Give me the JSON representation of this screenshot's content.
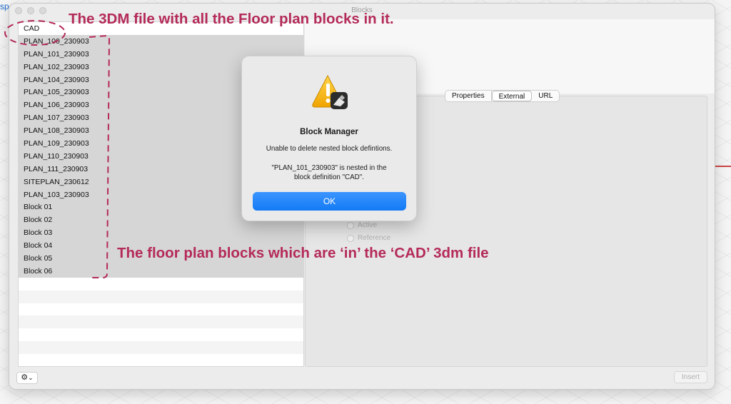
{
  "backdrop": {
    "left_text": "sp"
  },
  "window": {
    "title": "Blocks"
  },
  "block_list": [
    "CAD",
    "PLAN_100_230903",
    "PLAN_101_230903",
    "PLAN_102_230903",
    "PLAN_104_230903",
    "PLAN_105_230903",
    "PLAN_106_230903",
    "PLAN_107_230903",
    "PLAN_108_230903",
    "PLAN_109_230903",
    "PLAN_110_230903",
    "PLAN_111_230903",
    "SITEPLAN_230612",
    "PLAN_103_230903",
    "Block 01",
    "Block 02",
    "Block 03",
    "Block 04",
    "Block 05",
    "Block 06"
  ],
  "tabs": [
    "Properties",
    "External",
    "URL"
  ],
  "active_tab": "External",
  "radios": {
    "active_label": "Active",
    "reference_label": "Reference"
  },
  "footer": {
    "gear_icon": "gear-icon",
    "gear_glyph": "⚙",
    "chevron": "⌄",
    "insert_label": "Insert"
  },
  "dialog": {
    "icon": "warning-icon",
    "title": "Block Manager",
    "message": "Unable to delete nested block defintions.",
    "detail_line1": "\"PLAN_101_230903\" is nested in the",
    "detail_line2": "block definition \"CAD\".",
    "ok_label": "OK"
  },
  "annotations": {
    "top": "The 3DM file with all the Floor plan blocks in it.",
    "bottom": "The floor plan blocks which are ‘in’ the ‘CAD’ 3dm file"
  },
  "colors": {
    "annotation": "#b42a59",
    "ok_button": "#137bf5",
    "list_highlight": "#d6d6d6"
  }
}
